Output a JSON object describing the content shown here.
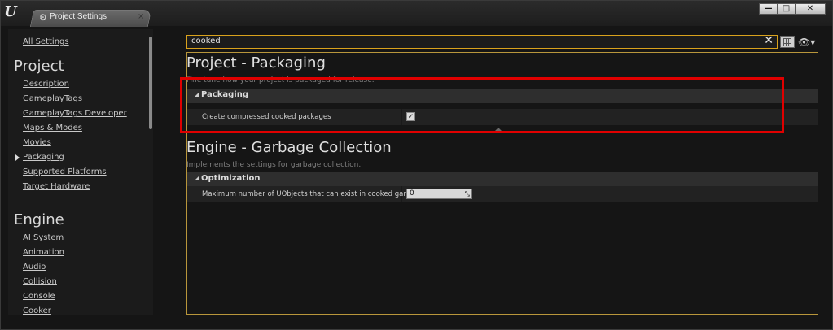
{
  "window": {
    "tab_title": "Project Settings",
    "tab_close": "×",
    "buttons": {
      "minimize": "—",
      "maximize": "□",
      "close": "✕"
    }
  },
  "sidebar": {
    "all_settings": "All Settings",
    "project_heading": "Project",
    "project_items": [
      "Description",
      "GameplayTags",
      "GameplayTags Developer",
      "Maps & Modes",
      "Movies",
      "Packaging",
      "Supported Platforms",
      "Target Hardware"
    ],
    "engine_heading": "Engine",
    "engine_items": [
      "AI System",
      "Animation",
      "Audio",
      "Collision",
      "Console",
      "Cooker"
    ],
    "selected": "Packaging"
  },
  "search": {
    "value": "cooked",
    "clear": "✕"
  },
  "toolbar": {
    "eye_icon": "eye-icon",
    "grid_icon": "grid-icon"
  },
  "sections": {
    "packaging": {
      "title": "Project - Packaging",
      "description": "Fine tune how your project is packaged for release.",
      "category": "Packaging",
      "property_label": "Create compressed cooked packages",
      "checked": true
    },
    "gc": {
      "title": "Engine - Garbage Collection",
      "description": "Implements the settings for garbage collection.",
      "category": "Optimization",
      "property_label": "Maximum number of UObjects that can exist in cooked game",
      "value": "0"
    }
  },
  "colors": {
    "accent": "#d9a21c",
    "highlight": "#e00000",
    "background": "#151515"
  }
}
